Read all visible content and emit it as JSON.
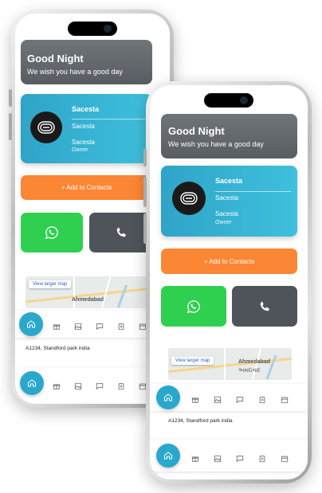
{
  "greeting": {
    "title": "Good Night",
    "subtitle": "We wish you have a good day"
  },
  "profile": {
    "name": "Sacesta",
    "company": "Sacesta",
    "company2": "Sacesta",
    "role": "Owner"
  },
  "actions": {
    "add_contacts": "+ Add to Contacts",
    "whatsapp_icon": "whatsapp-icon",
    "phone_icon": "phone-icon"
  },
  "map": {
    "link": "View larger map",
    "city": "Ahmedabad",
    "city_local": "અમદાવાદ"
  },
  "address": "A1234, Standford park india",
  "colors": {
    "accent": "#2aa8cb",
    "orange": "#fb8633",
    "green": "#2fd04f",
    "dark": "#4e5459"
  }
}
